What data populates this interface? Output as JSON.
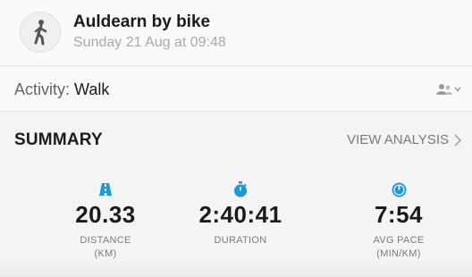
{
  "header": {
    "title": "Auldearn by bike",
    "subtitle": "Sunday 21 Aug at 09:48",
    "activity_icon": "walk-icon"
  },
  "activity": {
    "label": "Activity:",
    "value": "Walk",
    "share_icon": "people-icon"
  },
  "summary": {
    "title": "SUMMARY",
    "view_analysis": "VIEW ANALYSIS"
  },
  "stats": [
    {
      "icon": "distance-road-icon",
      "value": "20.33",
      "label_line1": "DISTANCE",
      "label_line2": "(KM)"
    },
    {
      "icon": "stopwatch-icon",
      "value": "2:40:41",
      "label_line1": "DURATION",
      "label_line2": ""
    },
    {
      "icon": "pace-gauge-icon",
      "value": "7:54",
      "label_line1": "AVG PACE",
      "label_line2": "(MIN/KM)"
    }
  ],
  "colors": {
    "accent": "#1a9ad6"
  }
}
